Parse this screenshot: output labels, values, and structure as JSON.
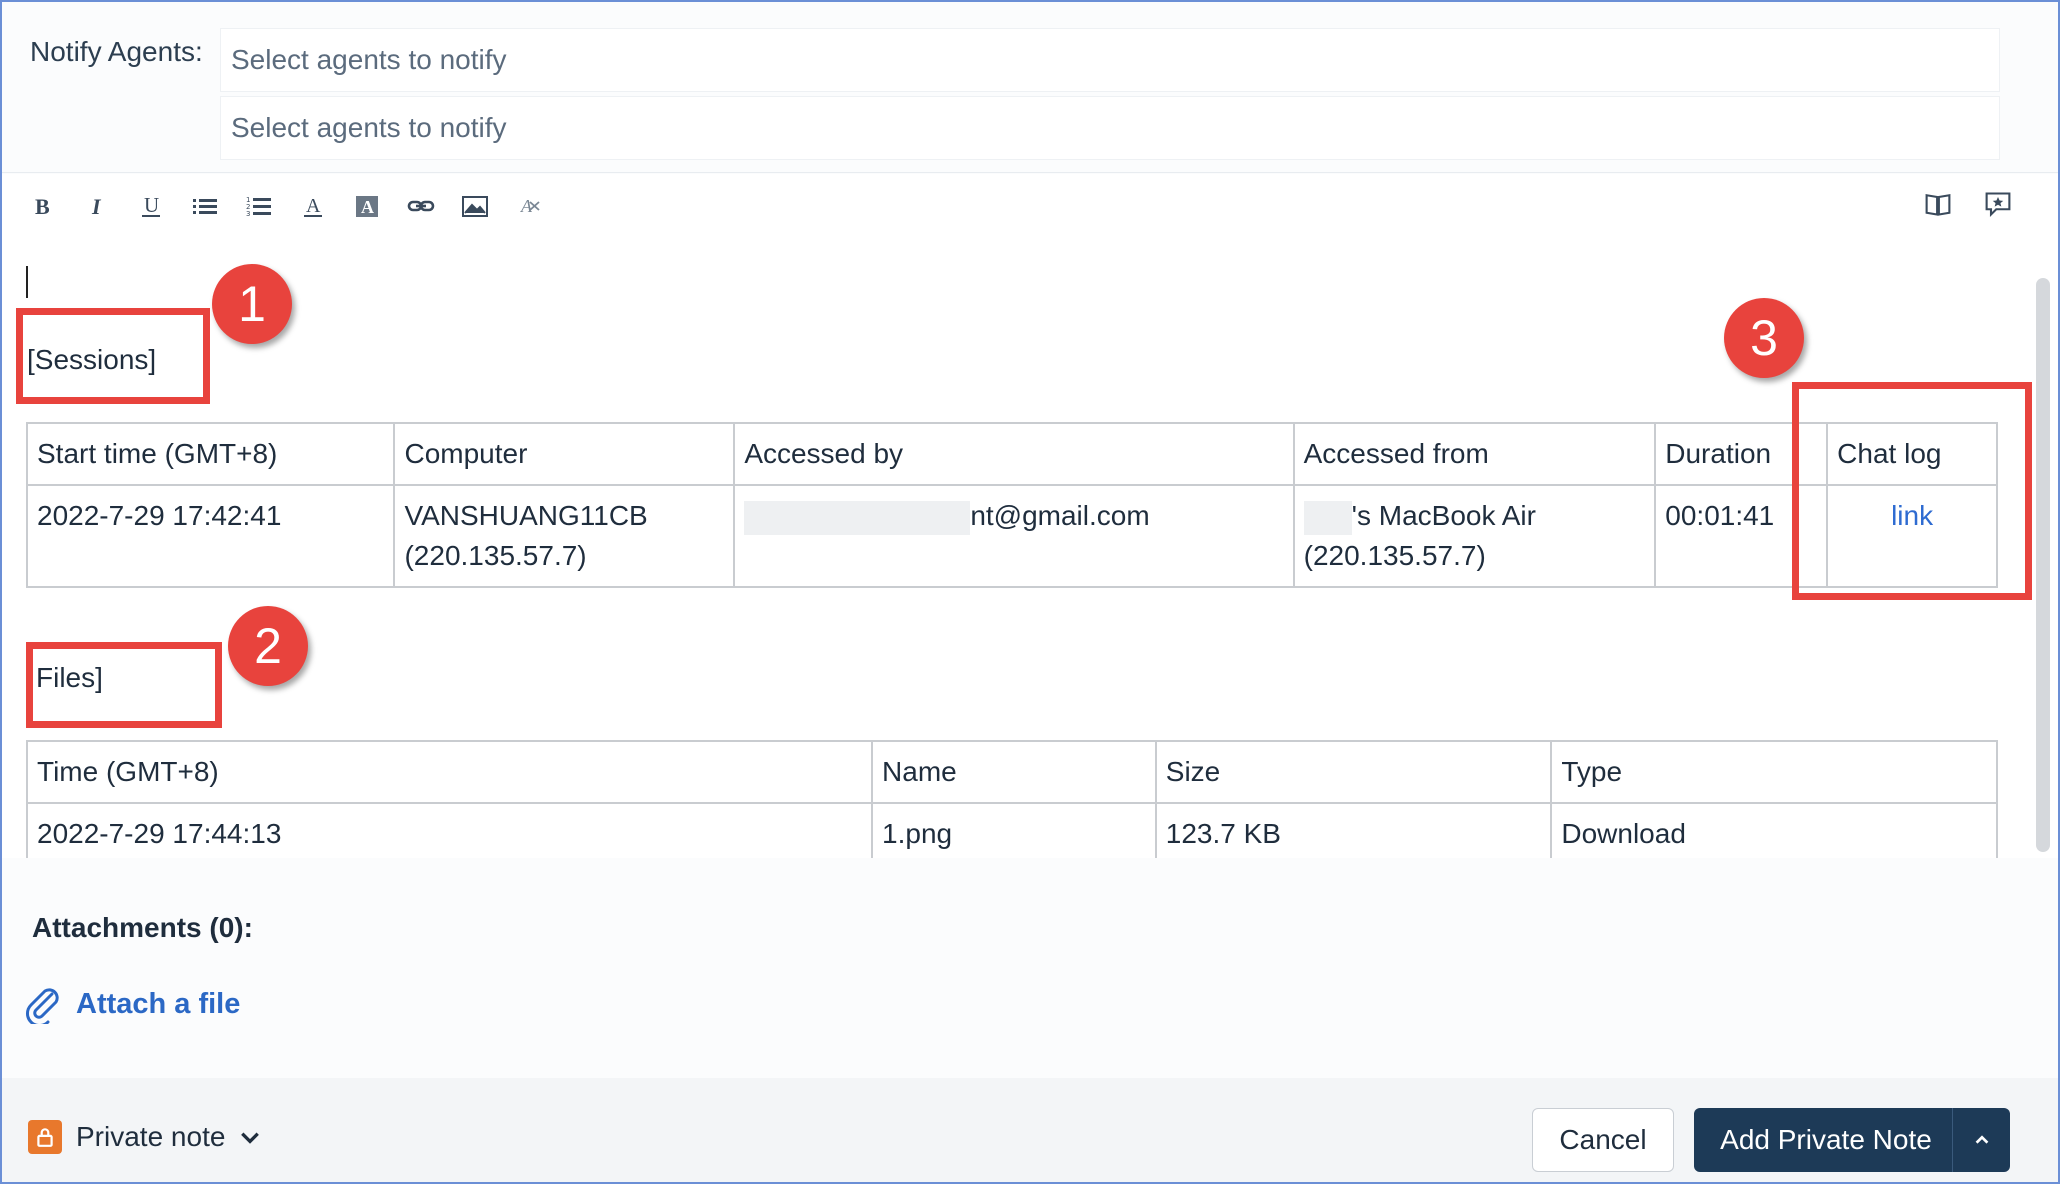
{
  "notify": {
    "label": "Notify Agents:",
    "placeholder_1": "Select agents to notify",
    "placeholder_2": "Select agents to notify"
  },
  "toolbar": {
    "left_icons": [
      "bold-icon",
      "italic-icon",
      "underline-icon",
      "bullet-list-icon",
      "numbered-list-icon",
      "font-color-icon",
      "background-color-icon",
      "link-icon",
      "image-icon",
      "clear-format-icon"
    ],
    "right_icons": [
      "book-icon",
      "comment-star-icon"
    ]
  },
  "editor": {
    "sessions_title": "[Sessions]",
    "sessions_table": {
      "headers": [
        "Start time (GMT+8)",
        "Computer",
        "Accessed by",
        "Accessed from",
        "Duration",
        "Chat log"
      ],
      "row": {
        "start_time": "2022-7-29 17:42:41",
        "computer_name": "VANSHUANG11CB",
        "computer_ip": "(220.135.57.7)",
        "accessed_by_suffix": "nt@gmail.com",
        "accessed_from_name": "'s MacBook Air",
        "accessed_from_ip": "(220.135.57.7)",
        "duration": "00:01:41",
        "chat_log": "link"
      }
    },
    "files_title": "Files]",
    "files_table": {
      "headers": [
        "Time (GMT+8)",
        "Name",
        "Size",
        "Type"
      ],
      "row": {
        "time": "2022-7-29 17:44:13",
        "name": "1.png",
        "size": "123.7 KB",
        "type": "Download"
      }
    }
  },
  "annotations": [
    "1",
    "2",
    "3"
  ],
  "attachments": {
    "title": "Attachments (0):",
    "attach_link": "Attach a file"
  },
  "footer": {
    "note_type": "Private note",
    "cancel_label": "Cancel",
    "submit_label": "Add Private Note"
  },
  "colors": {
    "annotation": "#e8433d",
    "link": "#2b68c5",
    "primary_button": "#1d3a57",
    "lock_badge": "#e8782c"
  }
}
